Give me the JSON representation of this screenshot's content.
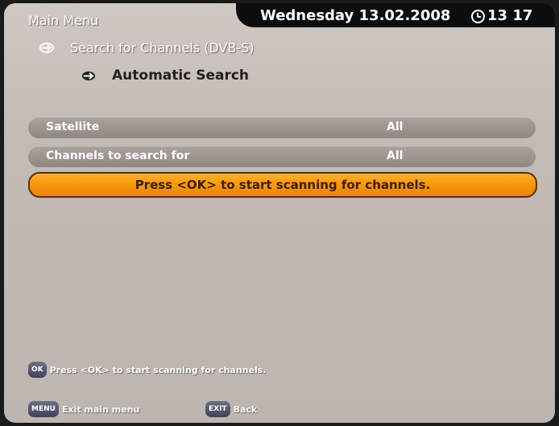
{
  "header": {
    "title": "Main Menu",
    "date": "Wednesday 13.02.2008",
    "time": "13 17"
  },
  "breadcrumb": {
    "level1": "Search for Channels (DVB-S)",
    "level2": "Automatic Search"
  },
  "settings": [
    {
      "label": "Satellite",
      "value": "All"
    },
    {
      "label": "Channels to search for",
      "value": "All"
    }
  ],
  "action": {
    "label": "Press <OK> to start scanning for channels."
  },
  "hint": {
    "key": "OK",
    "text": "Press <OK> to start scanning for channels."
  },
  "footer": {
    "menu_key": "MENU",
    "menu_label": "Exit main menu",
    "exit_key": "EXIT",
    "exit_label": "Back"
  },
  "colors": {
    "highlight": "#f6950a",
    "background": "#c2bab4"
  }
}
